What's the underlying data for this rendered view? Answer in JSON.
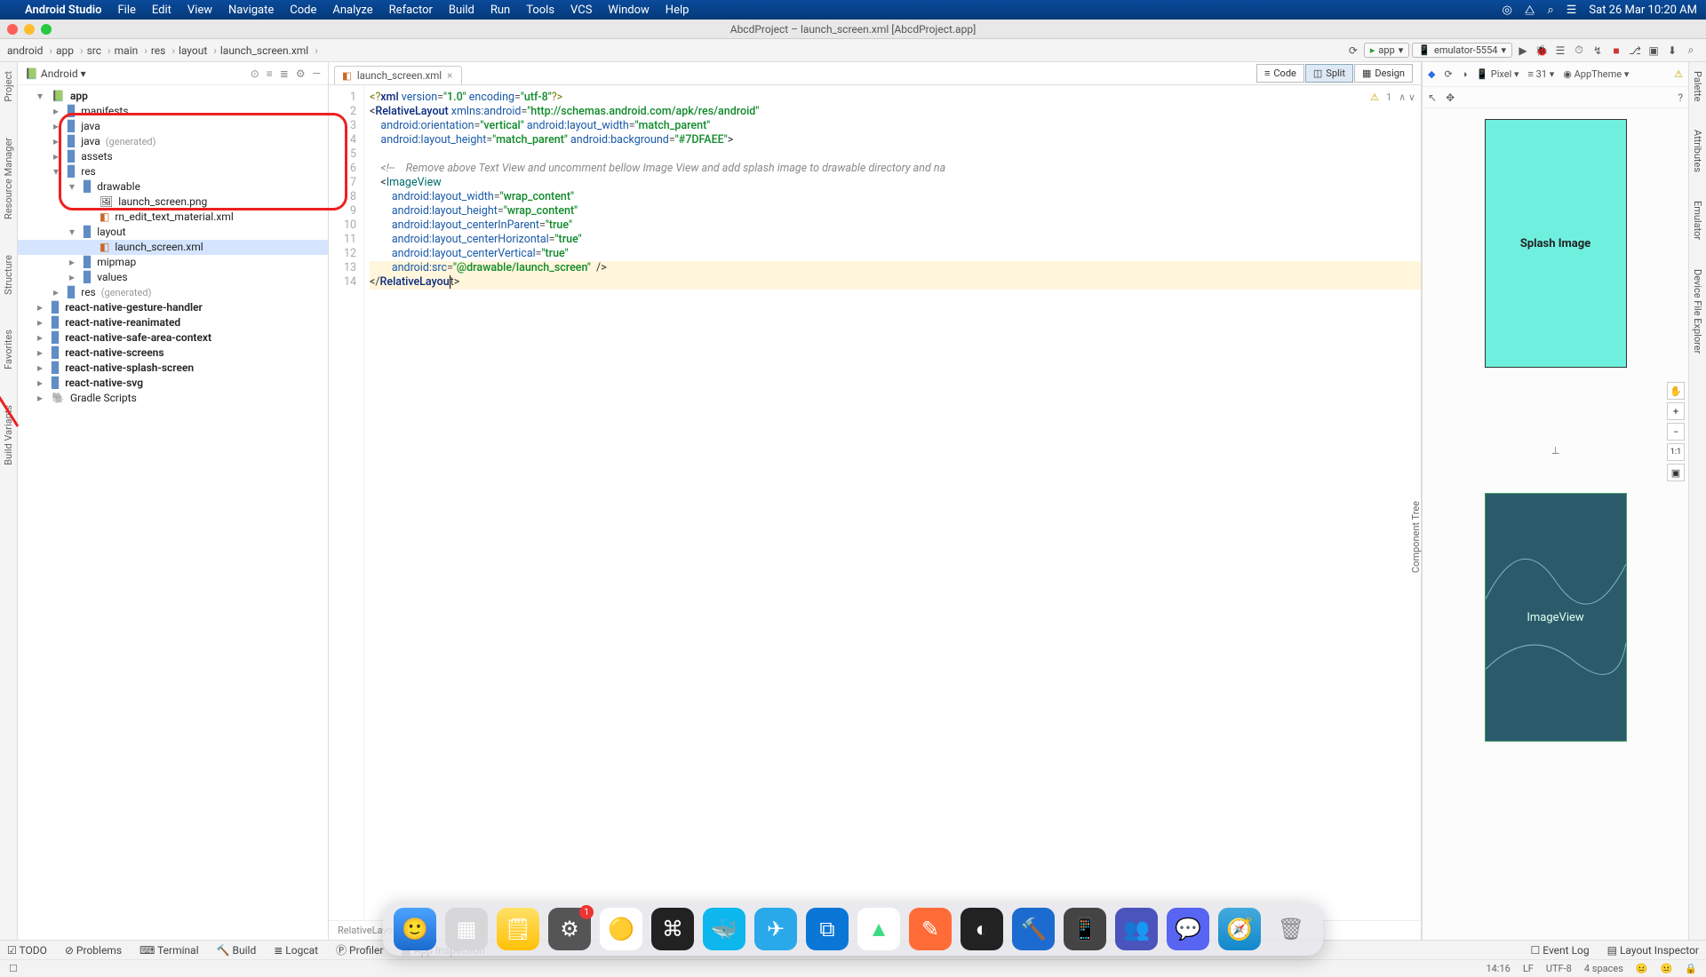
{
  "mac": {
    "app": "Android Studio",
    "menus": [
      "File",
      "Edit",
      "View",
      "Navigate",
      "Code",
      "Analyze",
      "Refactor",
      "Build",
      "Run",
      "Tools",
      "VCS",
      "Window",
      "Help"
    ],
    "datetime": "Sat 26 Mar 10:20 AM"
  },
  "window": {
    "title": "AbcdProject – launch_screen.xml [AbcdProject.app]"
  },
  "breadcrumb": [
    "android",
    "app",
    "src",
    "main",
    "res",
    "layout",
    "launch_screen.xml"
  ],
  "run": {
    "config": "app",
    "device": "emulator-5554"
  },
  "tree": {
    "dropdown": "Android",
    "items": [
      {
        "d": 0,
        "arrow": "▾",
        "ico": "app",
        "label": "app",
        "bold": true
      },
      {
        "d": 1,
        "arrow": "▸",
        "ico": "folder",
        "label": "manifests"
      },
      {
        "d": 1,
        "arrow": "▸",
        "ico": "folder",
        "label": "java"
      },
      {
        "d": 1,
        "arrow": "▸",
        "ico": "folder",
        "label": "java",
        "muted": "(generated)"
      },
      {
        "d": 1,
        "arrow": "▸",
        "ico": "folder",
        "label": "assets"
      },
      {
        "d": 1,
        "arrow": "▾",
        "ico": "folder",
        "label": "res"
      },
      {
        "d": 2,
        "arrow": "▾",
        "ico": "folder",
        "label": "drawable"
      },
      {
        "d": 3,
        "arrow": "",
        "ico": "png",
        "label": "launch_screen.png"
      },
      {
        "d": 3,
        "arrow": "",
        "ico": "xml",
        "label": "rn_edit_text_material.xml"
      },
      {
        "d": 2,
        "arrow": "▾",
        "ico": "folder",
        "label": "layout"
      },
      {
        "d": 3,
        "arrow": "",
        "ico": "xml",
        "label": "launch_screen.xml",
        "selected": true
      },
      {
        "d": 2,
        "arrow": "▸",
        "ico": "folder",
        "label": "mipmap"
      },
      {
        "d": 2,
        "arrow": "▸",
        "ico": "folder",
        "label": "values"
      },
      {
        "d": 1,
        "arrow": "▸",
        "ico": "folder",
        "label": "res",
        "muted": "(generated)"
      },
      {
        "d": 0,
        "arrow": "▸",
        "ico": "folder",
        "label": "react-native-gesture-handler",
        "bold": true
      },
      {
        "d": 0,
        "arrow": "▸",
        "ico": "folder",
        "label": "react-native-reanimated",
        "bold": true
      },
      {
        "d": 0,
        "arrow": "▸",
        "ico": "folder",
        "label": "react-native-safe-area-context",
        "bold": true
      },
      {
        "d": 0,
        "arrow": "▸",
        "ico": "folder",
        "label": "react-native-screens",
        "bold": true
      },
      {
        "d": 0,
        "arrow": "▸",
        "ico": "folder",
        "label": "react-native-splash-screen",
        "bold": true
      },
      {
        "d": 0,
        "arrow": "▸",
        "ico": "folder",
        "label": "react-native-svg",
        "bold": true
      },
      {
        "d": 0,
        "arrow": "▸",
        "ico": "gradle",
        "label": "Gradle Scripts"
      }
    ]
  },
  "tab": {
    "name": "launch_screen.xml"
  },
  "modes": {
    "code": "Code",
    "split": "Split",
    "design": "Design",
    "active": "Split"
  },
  "code": {
    "line_count": 14,
    "breadcrumb": "RelativeLayout",
    "comment_text": "Remove above Text View and uncomment bellow Image View and add splash image to drawable directory and na",
    "xmlns_url": "http://schemas.android.com/apk/res/android",
    "bg_color": "#7DFAEE",
    "src_val": "@drawable/launch_screen",
    "warnings": "1"
  },
  "design": {
    "device": "Pixel",
    "api": "31",
    "theme": "AppTheme",
    "splash_label": "Splash Image",
    "blueprint_label": "ImageView"
  },
  "bottom": {
    "items": [
      "TODO",
      "Problems",
      "Terminal",
      "Build",
      "Logcat",
      "Profiler",
      "App Inspection"
    ],
    "right": [
      "Event Log",
      "Layout Inspector"
    ]
  },
  "status": {
    "pos": "14:16",
    "le": "LF",
    "enc": "UTF-8",
    "indent": "4 spaces"
  },
  "leftrail": [
    "Project",
    "Resource Manager",
    "Structure",
    "Favorites",
    "Build Variants"
  ],
  "rightrail": [
    "Palette",
    "Attributes",
    "Emulator",
    "Device File Explorer"
  ],
  "componenttree": "Component Tree"
}
